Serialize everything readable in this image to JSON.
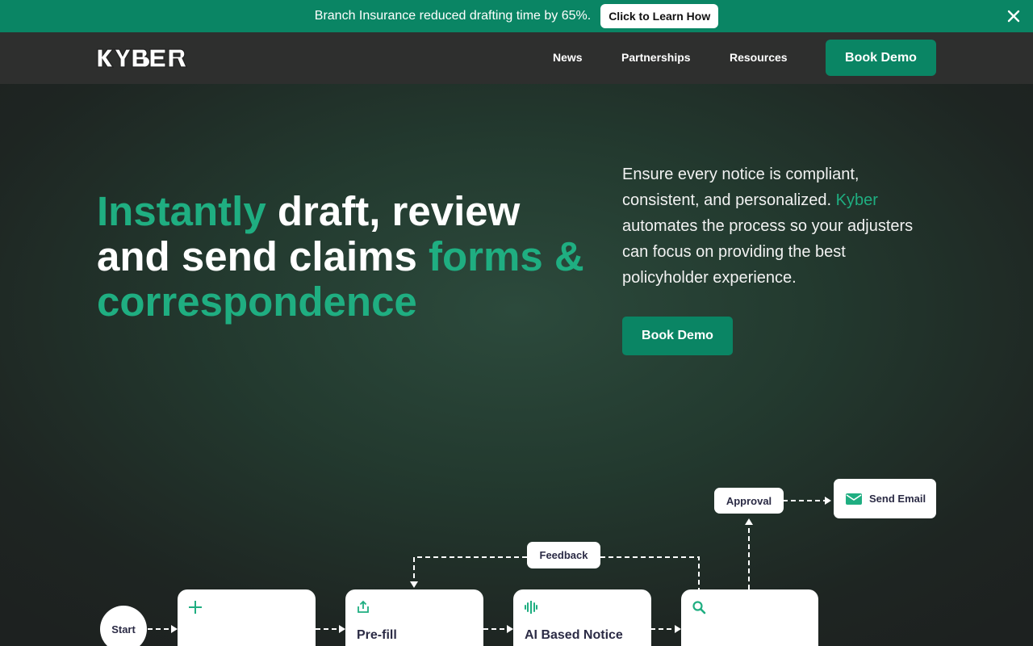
{
  "announcement": {
    "text": "Branch Insurance reduced drafting time by 65%.",
    "cta_label": "Click to Learn How",
    "close_icon": "close-icon"
  },
  "nav": {
    "logo_text": "KYBER",
    "links": [
      "News",
      "Partnerships",
      "Resources"
    ],
    "demo_label": "Book Demo"
  },
  "hero": {
    "headline": {
      "part1": "Instantly",
      "part2": " draft, review and send claims ",
      "part3": "forms & correspondence"
    },
    "description": {
      "part1": "Ensure every notice is compliant, consistent, and personalized. ",
      "kyber": "Kyber",
      "part2": " automates the process so your adjusters can focus on providing the best policyholder experience."
    },
    "demo_label": "Book Demo"
  },
  "diagram": {
    "start_label": "Start",
    "feedback_label": "Feedback",
    "approval_label": "Approval",
    "send_email_label": "Send Email",
    "cards": [
      {
        "title": "",
        "icon": "plus-icon"
      },
      {
        "title": "Pre-fill",
        "icon": "upload-icon"
      },
      {
        "title": "AI Based Notice",
        "icon": "ai-icon"
      },
      {
        "title": "",
        "icon": "search-icon"
      }
    ]
  },
  "colors": {
    "brand_green": "#0a8564",
    "accent_green": "#1fae81",
    "nav_bg": "#2e2f2e"
  }
}
